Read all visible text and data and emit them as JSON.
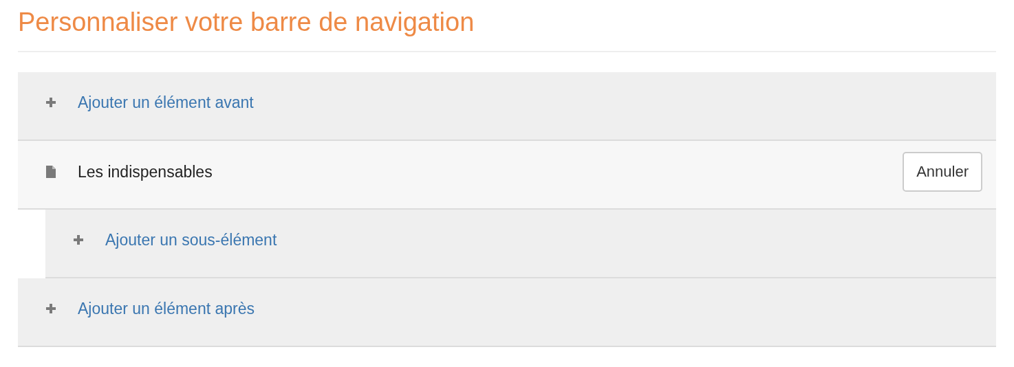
{
  "title": "Personnaliser votre barre de navigation",
  "rows": [
    {
      "kind": "add",
      "label": "Ajouter un élément avant"
    },
    {
      "kind": "item",
      "label": "Les indispensables",
      "button": "Annuler",
      "children": [
        {
          "kind": "add",
          "label": "Ajouter un sous-élément"
        }
      ]
    },
    {
      "kind": "add",
      "label": "Ajouter un élément après"
    }
  ]
}
